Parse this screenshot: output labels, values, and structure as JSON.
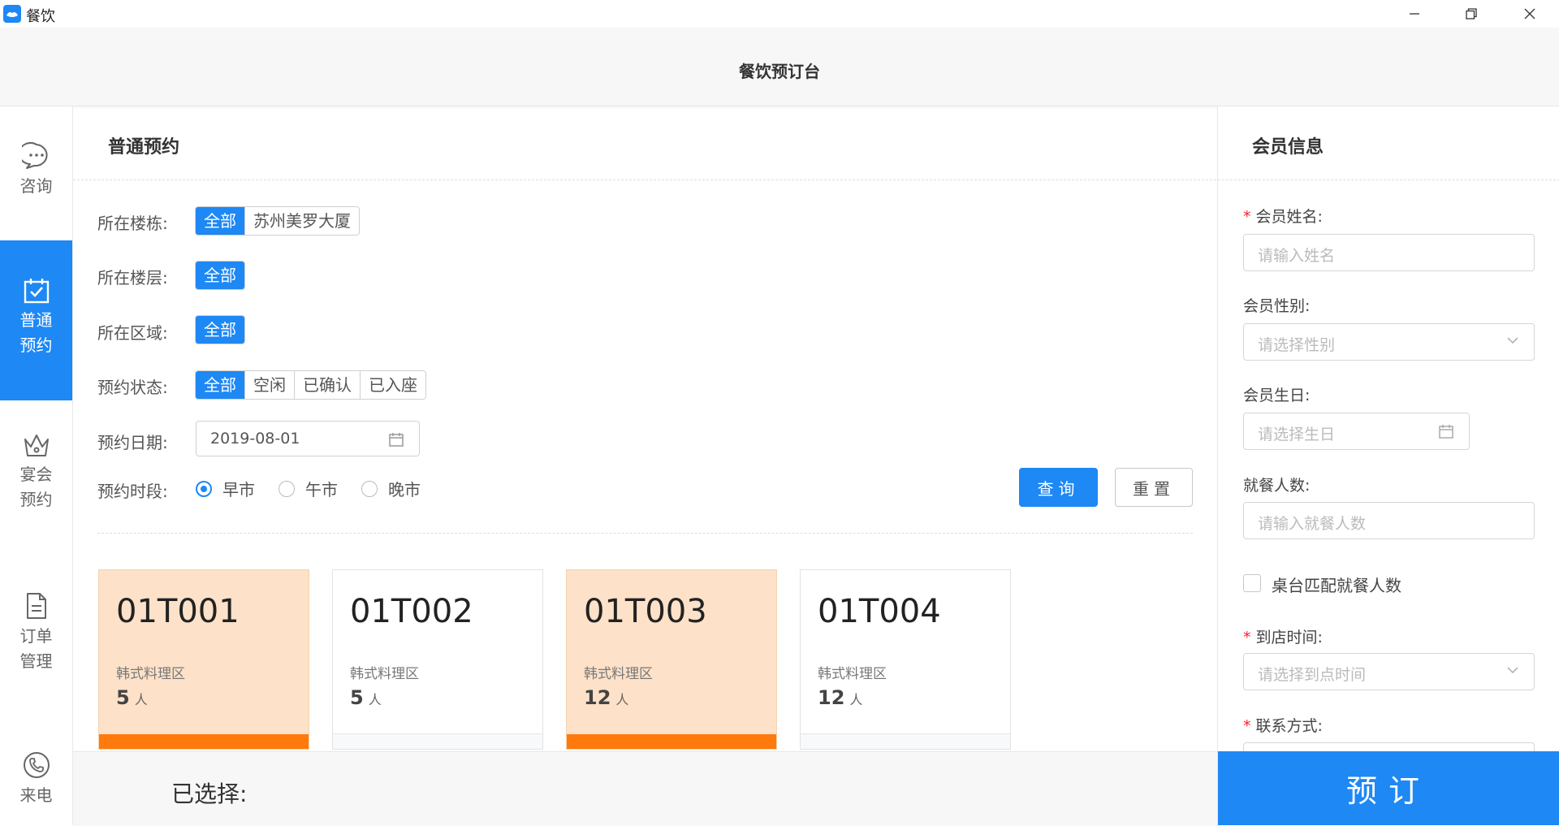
{
  "window": {
    "app_title": "餐饮",
    "controls": [
      "minimize",
      "restore",
      "close"
    ]
  },
  "header": {
    "title": "餐饮预订台"
  },
  "sidebar": {
    "items": [
      {
        "label_line1": "咨询",
        "label_line2": "",
        "icon": "chat-bubble-icon",
        "active": false
      },
      {
        "label_line1": "普通",
        "label_line2": "预约",
        "icon": "calendar-check-icon",
        "active": true
      },
      {
        "label_line1": "宴会",
        "label_line2": "预约",
        "icon": "crown-icon",
        "active": false
      },
      {
        "label_line1": "订单",
        "label_line2": "管理",
        "icon": "document-icon",
        "active": false
      },
      {
        "label_line1": "来电",
        "label_line2": "",
        "icon": "phone-icon",
        "active": false
      }
    ]
  },
  "main": {
    "title": "普通预约",
    "filters": {
      "building_label": "所在楼栋:",
      "building_options": [
        "全部",
        "苏州美罗大厦"
      ],
      "floor_label": "所在楼层:",
      "floor_options": [
        "全部"
      ],
      "area_label": "所在区域:",
      "area_options": [
        "全部"
      ],
      "status_label": "预约状态:",
      "status_options": [
        "全部",
        "空闲",
        "已确认",
        "已入座"
      ],
      "date_label": "预约日期:",
      "date_value": "2019-08-01",
      "period_label": "预约时段:",
      "period_options": [
        "早市",
        "午市",
        "晚市"
      ],
      "period_selected": "早市"
    },
    "query_label": "查询",
    "reset_label": "重置",
    "tables": [
      {
        "no": "01T001",
        "zone": "韩式料理区",
        "count": "5",
        "unit": "人",
        "occupied": true
      },
      {
        "no": "01T002",
        "zone": "韩式料理区",
        "count": "5",
        "unit": "人",
        "occupied": false
      },
      {
        "no": "01T003",
        "zone": "韩式料理区",
        "count": "12",
        "unit": "人",
        "occupied": true
      },
      {
        "no": "01T004",
        "zone": "韩式料理区",
        "count": "12",
        "unit": "人",
        "occupied": false
      }
    ],
    "selected_label": "已选择:"
  },
  "member": {
    "title": "会员信息",
    "name_label": "会员姓名:",
    "name_placeholder": "请输入姓名",
    "gender_label": "会员性别:",
    "gender_placeholder": "请选择性别",
    "birthday_label": "会员生日:",
    "birthday_placeholder": "请选择生日",
    "guests_label": "就餐人数:",
    "guests_placeholder": "请输入就餐人数",
    "match_label": "桌台匹配就餐人数",
    "arrival_label": "到店时间:",
    "arrival_placeholder": "请选择到点时间",
    "contact_label": "联系方式:"
  },
  "book_label": "预订",
  "colors": {
    "accent": "#1e88f5",
    "occupied_bg": "#fde1c8",
    "occupied_bar": "#ff7a0c",
    "required": "#f5222d"
  }
}
